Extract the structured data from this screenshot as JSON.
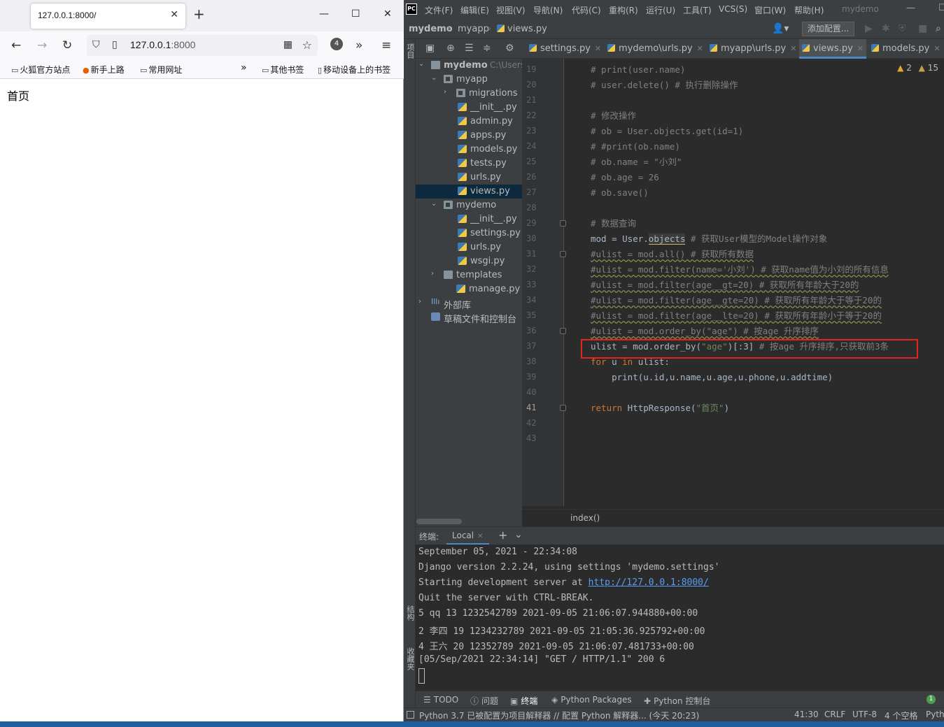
{
  "browser": {
    "tab_title": "127.0.0.1:8000/",
    "url_host": "127.0.0.1",
    "url_port": ":8000",
    "extension_badge": "4",
    "bookmarks": [
      "火狐官方站点",
      "新手上路",
      "常用网址",
      "其他书签",
      "移动设备上的书签"
    ],
    "page_text": "首页"
  },
  "ide": {
    "menu": [
      "文件(F)",
      "编辑(E)",
      "视图(V)",
      "导航(N)",
      "代码(C)",
      "重构(R)",
      "运行(U)",
      "工具(T)",
      "VCS(S)",
      "窗口(W)",
      "帮助(H)"
    ],
    "project_name": "mydemo",
    "nav": [
      "mydemo",
      "myapp",
      "views.py"
    ],
    "add_config": "添加配置...",
    "side_labels": {
      "project": "项目",
      "structure": "结构",
      "favorites": "收藏夹"
    },
    "tree": [
      {
        "label": "mydemo",
        "hint": "C:\\Users\\",
        "level": 0,
        "type": "folder",
        "open": true
      },
      {
        "label": "myapp",
        "level": 1,
        "type": "pkgfolder",
        "open": true
      },
      {
        "label": "migrations",
        "level": 2,
        "type": "pkgfolder",
        "open": false
      },
      {
        "label": "__init__.py",
        "level": 3,
        "type": "py"
      },
      {
        "label": "admin.py",
        "level": 3,
        "type": "py"
      },
      {
        "label": "apps.py",
        "level": 3,
        "type": "py"
      },
      {
        "label": "models.py",
        "level": 3,
        "type": "py"
      },
      {
        "label": "tests.py",
        "level": 3,
        "type": "py"
      },
      {
        "label": "urls.py",
        "level": 3,
        "type": "py"
      },
      {
        "label": "views.py",
        "level": 3,
        "type": "py",
        "selected": true
      },
      {
        "label": "mydemo",
        "level": 1,
        "type": "pkgfolder",
        "open": true
      },
      {
        "label": "__init__.py",
        "level": 3,
        "type": "py"
      },
      {
        "label": "settings.py",
        "level": 3,
        "type": "py"
      },
      {
        "label": "urls.py",
        "level": 3,
        "type": "py"
      },
      {
        "label": "wsgi.py",
        "level": 3,
        "type": "py"
      },
      {
        "label": "templates",
        "level": 1,
        "type": "folder",
        "open": false
      },
      {
        "label": "manage.py",
        "level": 2,
        "type": "py"
      },
      {
        "label": "外部库",
        "level": 0,
        "type": "lib",
        "open": false
      },
      {
        "label": "草稿文件和控制台",
        "level": 0,
        "type": "scratch"
      }
    ],
    "editor_tabs": [
      "settings.py",
      "mydemo\\urls.py",
      "myapp\\urls.py",
      "views.py",
      "models.py"
    ],
    "active_tab": "views.py",
    "warnings": {
      "warn": "2",
      "weak": "15"
    },
    "line_numbers": [
      "19",
      "20",
      "21",
      "22",
      "23",
      "24",
      "25",
      "26",
      "27",
      "28",
      "29",
      "30",
      "31",
      "32",
      "33",
      "34",
      "35",
      "36",
      "37",
      "38",
      "39",
      "40",
      "41",
      "42",
      "43"
    ],
    "code": {
      "l19": "# print(user.name)",
      "l20": "# user.delete() # 执行删除操作",
      "l22": "# 修改操作",
      "l23": "# ob = User.objects.get(id=1)",
      "l24": "# #print(ob.name)",
      "l25": "# ob.name = \"小刘\"",
      "l26": "# ob.age = 26",
      "l27": "# ob.save()",
      "l29": "# 数据查询",
      "l30a": "mod = User.",
      "l30b": "objects",
      "l30c": " # 获取User模型的Model操作对象",
      "l31": "#ulist = mod.all() # 获取所有数据",
      "l32": "#ulist = mod.filter(name='小刘') # 获取name值为小刘的所有信息",
      "l33": "#ulist = mod.filter(age__gt=20) # 获取所有年龄大于20的",
      "l34": "#ulist = mod.filter(age__gte=20) # 获取所有年龄大于等于20的",
      "l35": "#ulist = mod.filter(age__lte=20) # 获取所有年龄小于等于20的",
      "l36": "#ulist = mod.order_by(\"age\") # 按age 升序排序",
      "l37a": "ulist = mod.order_by(",
      "l37b": "\"age\"",
      "l37c": ")[:3] ",
      "l37d": "# 按age 升序排序,只获取前3条",
      "l38a": "for",
      "l38b": " u ",
      "l38c": "in",
      "l38d": " ulist:",
      "l39": "    print(u.id,u.name,u.age,u.phone,u.addtime)",
      "l41a": "return",
      "l41b": " HttpResponse(",
      "l41c": "\"首页\"",
      "l41d": ")"
    },
    "function_breadcrumb": "index()",
    "terminal": {
      "title": "终端:",
      "tab": "Local",
      "lines": [
        "September 05, 2021 - 22:34:08",
        "Django version 2.2.24, using settings 'mydemo.settings'",
        "Starting development server at ",
        "Quit the server with CTRL-BREAK.",
        "5 qq 13 1232542789 2021-09-05 21:06:07.944880+00:00",
        "2 李四 19 1234232789 2021-09-05 21:05:36.925792+00:00",
        "4 王六 20 12352789 2021-09-05 21:06:07.481733+00:00",
        "[05/Sep/2021 22:34:14] \"GET / HTTP/1.1\" 200 6"
      ],
      "link": "http://127.0.0.1:8000/"
    },
    "tool_tabs": [
      "TODO",
      "问题",
      "终端",
      "Python Packages",
      "Python 控制台"
    ],
    "ok_count": "1",
    "status": {
      "message": "Python 3.7 已被配置为项目解释器 // 配置 Python 解释器... (今天 20:23)",
      "position": "41:30",
      "line_sep": "CRLF",
      "encoding": "UTF-8",
      "indent": "4 个空格",
      "interpreter": "Pyth"
    }
  }
}
